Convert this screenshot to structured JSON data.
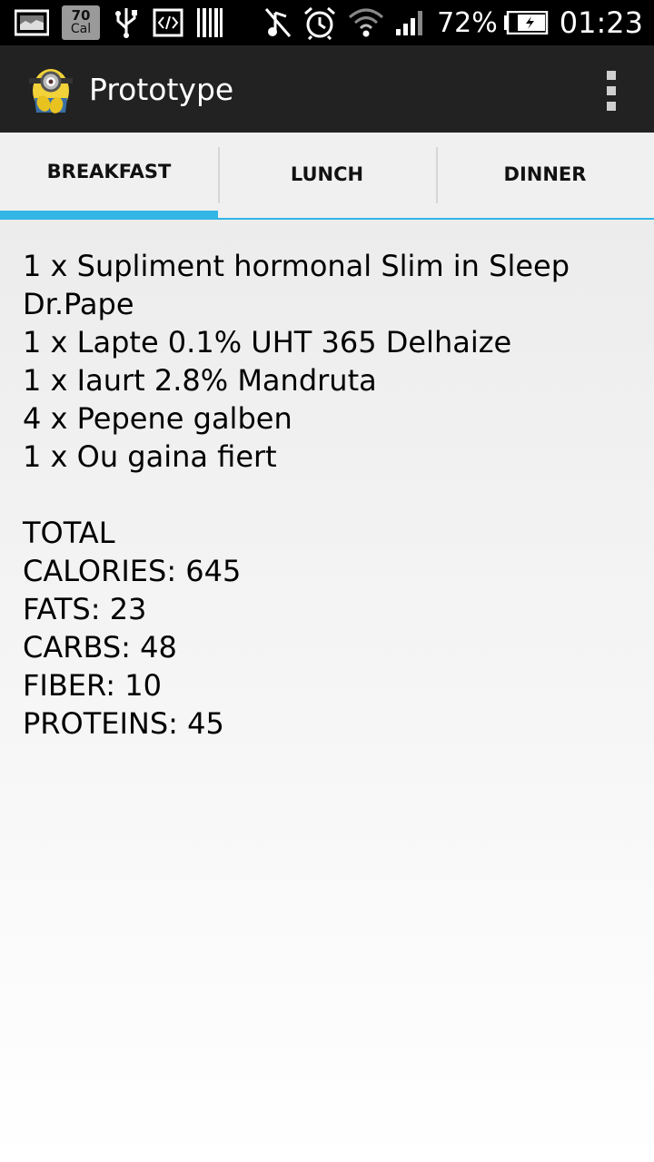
{
  "status_bar": {
    "calorie_badge": {
      "value": "70",
      "unit": "Cal"
    },
    "battery_percent": "72%",
    "time": "01:23",
    "icons": [
      "screenshot-icon",
      "calorie-badge-icon",
      "usb-icon",
      "developer-icon",
      "barcode-icon",
      "music-muted-icon",
      "alarm-icon",
      "wifi-icon",
      "signal-icon",
      "battery-charging-icon"
    ]
  },
  "action_bar": {
    "title": "Prototype",
    "logo_icon": "minion-logo-icon",
    "menu_icon": "overflow-menu-icon"
  },
  "tabs": [
    {
      "label": "BREAKFAST",
      "selected": true
    },
    {
      "label": "LUNCH",
      "selected": false
    },
    {
      "label": "DINNER",
      "selected": false
    }
  ],
  "meal": {
    "items": [
      "1 x Supliment hormonal Slim in Sleep",
      "Dr.Pape",
      "1 x Lapte 0.1% UHT 365 Delhaize",
      "1 x Iaurt 2.8% Mandruta",
      "4 x Pepene galben",
      "1 x Ou gaina fiert"
    ],
    "totals": [
      "TOTAL",
      "CALORIES: 645",
      "FATS: 23",
      "CARBS: 48",
      "FIBER: 10",
      "PROTEINS: 45"
    ]
  },
  "colors": {
    "accent": "#33b5e5",
    "action_bar": "#222222",
    "status_bar": "#000000"
  }
}
